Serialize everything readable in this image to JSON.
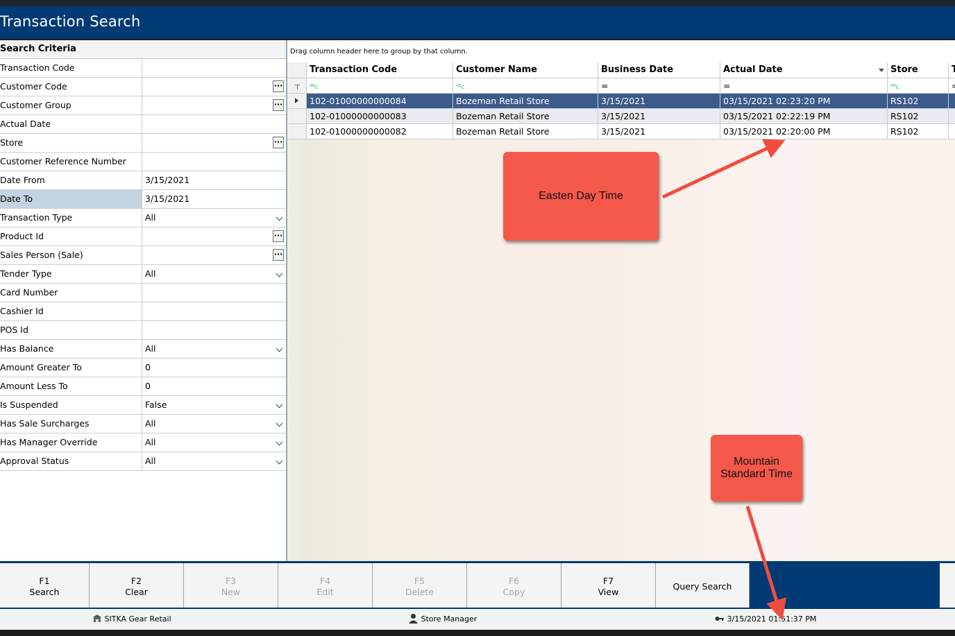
{
  "window": {
    "title": "Transaction Search"
  },
  "criteria": {
    "header": "Search Criteria",
    "rows": [
      {
        "label": "Transaction Code",
        "value": "",
        "control": "text"
      },
      {
        "label": "Customer Code",
        "value": "",
        "control": "ellipsis"
      },
      {
        "label": "Customer Group",
        "value": "",
        "control": "ellipsis"
      },
      {
        "label": "Actual Date",
        "value": "",
        "control": "text"
      },
      {
        "label": "Store",
        "value": "",
        "control": "ellipsis"
      },
      {
        "label": "Customer Reference Number",
        "value": "",
        "control": "text"
      },
      {
        "label": "Date From",
        "value": "3/15/2021",
        "control": "text"
      },
      {
        "label": "Date To",
        "value": "3/15/2021",
        "control": "text"
      },
      {
        "label": "Transaction Type",
        "value": "All",
        "control": "dropdown"
      },
      {
        "label": "Product Id",
        "value": "",
        "control": "ellipsis"
      },
      {
        "label": "Sales Person (Sale)",
        "value": "",
        "control": "ellipsis"
      },
      {
        "label": "Tender Type",
        "value": "All",
        "control": "dropdown"
      },
      {
        "label": "Card Number",
        "value": "",
        "control": "text"
      },
      {
        "label": "Cashier Id",
        "value": "",
        "control": "text"
      },
      {
        "label": "POS Id",
        "value": "",
        "control": "text"
      },
      {
        "label": "Has Balance",
        "value": "All",
        "control": "dropdown"
      },
      {
        "label": "Amount Greater To",
        "value": "0",
        "control": "text"
      },
      {
        "label": "Amount Less To",
        "value": "0",
        "control": "text"
      },
      {
        "label": "Is Suspended",
        "value": "False",
        "control": "dropdown"
      },
      {
        "label": "Has Sale Surcharges",
        "value": "All",
        "control": "dropdown"
      },
      {
        "label": "Has Manager Override",
        "value": "All",
        "control": "dropdown"
      },
      {
        "label": "Approval Status",
        "value": "All",
        "control": "dropdown"
      }
    ],
    "ellipsis_glyph": "···"
  },
  "grid": {
    "group_hint": "Drag column header here to group by that column.",
    "columns": [
      "Transaction Code",
      "Customer Name",
      "Business Date",
      "Actual Date",
      "Store",
      "T"
    ],
    "filter_row": [
      "ᴬᴮc",
      "ᴬᴮc",
      "=",
      "=",
      "ᴬᴮc",
      "="
    ],
    "rows": [
      [
        "102-01000000000084",
        "Bozeman Retail Store",
        "3/15/2021",
        "03/15/2021 02:23:20 PM",
        "RS102"
      ],
      [
        "102-01000000000083",
        "Bozeman Retail Store",
        "3/15/2021",
        "03/15/2021 02:22:19 PM",
        "RS102"
      ],
      [
        "102-01000000000082",
        "Bozeman Retail Store",
        "3/15/2021",
        "03/15/2021 02:20:00 PM",
        "RS102"
      ]
    ]
  },
  "callouts": {
    "eastern": "Easten Day Time",
    "mountain_line1": "Mountain",
    "mountain_line2": "Standard Time"
  },
  "function_keys": [
    {
      "key": "F1",
      "label": "Search",
      "enabled": true
    },
    {
      "key": "F2",
      "label": "Clear",
      "enabled": true
    },
    {
      "key": "F3",
      "label": "New",
      "enabled": false
    },
    {
      "key": "F4",
      "label": "Edit",
      "enabled": false
    },
    {
      "key": "F5",
      "label": "Delete",
      "enabled": false
    },
    {
      "key": "F6",
      "label": "Copy",
      "enabled": false
    },
    {
      "key": "F7",
      "label": "View",
      "enabled": true
    },
    {
      "key": "",
      "label": "Query Search",
      "enabled": true
    }
  ],
  "status": {
    "company": "SITKA Gear Retail",
    "user": "Store Manager",
    "datetime": "3/15/2021 01:51:37 PM"
  },
  "colors": {
    "title_bar": "#003a75",
    "selected_row": "#3c5a8a",
    "callout": "#f4584b",
    "arrow": "#f04d3f"
  }
}
